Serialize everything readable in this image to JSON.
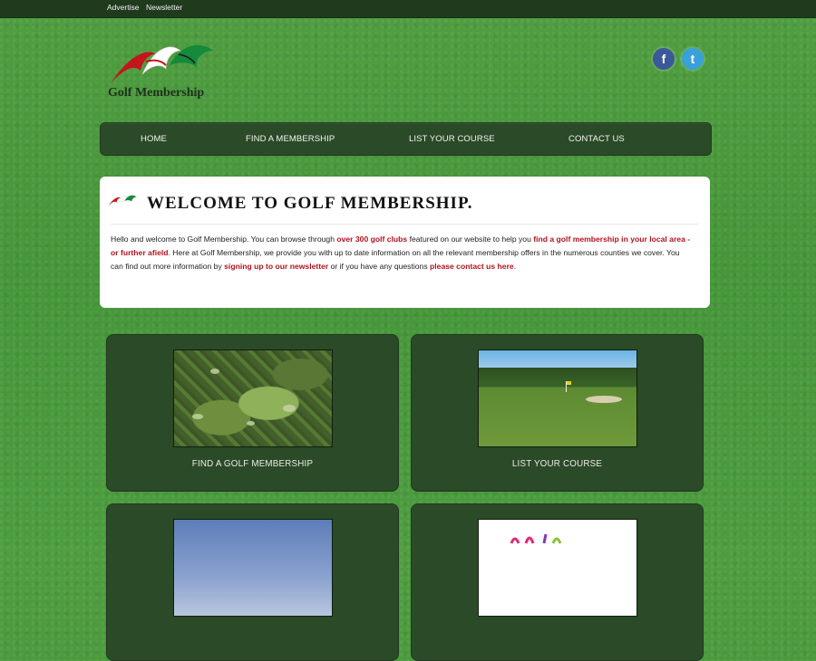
{
  "topbar": {
    "links": [
      "Advertise",
      "Newsletter"
    ]
  },
  "site": {
    "name": "Golf Membership"
  },
  "social": {
    "facebook": "f",
    "twitter": "t"
  },
  "nav": {
    "items": [
      "HOME",
      "FIND A MEMBERSHIP",
      "LIST YOUR COURSE",
      "CONTACT US"
    ]
  },
  "welcome": {
    "title": "WELCOME TO GOLF MEMBERSHIP.",
    "p_part1": "Hello and welcome to Golf Membership. You can browse through ",
    "link1": "over 300 golf clubs",
    "p_part2": " featured on our website to help you ",
    "link2": "find a golf membership in your local area - or further afield",
    "p_part3": ". Here at Golf Membership, we provide you with up to date information on all the relevant membership offers in the numerous counties we cover. You can find out more information by ",
    "link3": "signing up to our newsletter",
    "p_part4": " or if you have any questions ",
    "link4": "please contact us here",
    "p_part5": "."
  },
  "cards": [
    {
      "label": "FIND A GOLF MEMBERSHIP"
    },
    {
      "label": "LIST YOUR COURSE"
    }
  ],
  "colors": {
    "link_red": "#b3121e",
    "panel_green": "#2b4a27",
    "topbar": "#1f3a1d"
  }
}
